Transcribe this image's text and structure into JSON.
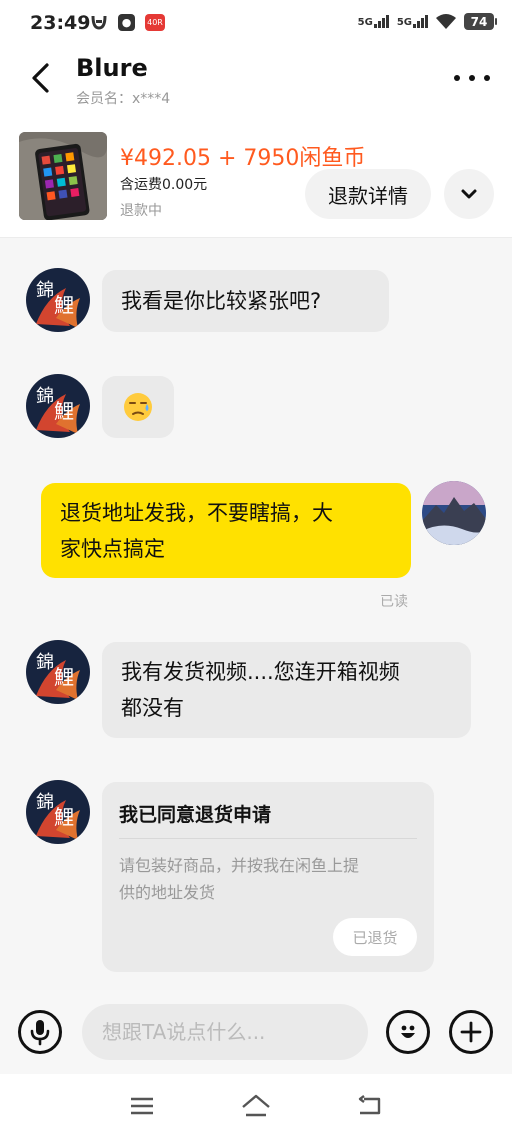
{
  "status_bar": {
    "time": "23:49",
    "signal_1": "5G",
    "signal_2": "5G",
    "battery": "74",
    "badge": "40R"
  },
  "header": {
    "name": "Blure",
    "member": "会员名：x***4"
  },
  "product": {
    "price": "¥492.05 + 7950闲鱼币",
    "shipping": "含运费0.00元",
    "status": "退款中",
    "refund_button": "退款详情"
  },
  "messages": [
    {
      "side": "in",
      "text": "我看是你比较紧张吧?"
    },
    {
      "side": "in",
      "text": "😓"
    },
    {
      "side": "out",
      "text": "退货地址发我，不要瞎搞，大家快点搞定",
      "line1": "退货地址发我，不要瞎搞，大",
      "line2": "家快点搞定",
      "status": "已读"
    },
    {
      "side": "in",
      "text": "我有发货视频....您连开箱视频都没有",
      "line1": "我有发货视频....您连开箱视频",
      "line2": "都没有"
    }
  ],
  "card": {
    "title": "我已同意退货申请",
    "body": "请包装好商品，并按我在闲鱼上提供的地址发货",
    "body_line1": "请包装好商品，并按我在闲鱼上提",
    "body_line2": "供的地址发货",
    "button": "已退货"
  },
  "input": {
    "placeholder": "想跟TA说点什么..."
  },
  "icons": {
    "back": "chevron-left-icon",
    "more": "more-dots-icon",
    "expand": "chevron-down-icon",
    "voice": "microphone-icon",
    "emoji": "emoji-icon",
    "add": "plus-icon",
    "nav_menu": "menu-icon",
    "nav_home": "home-icon",
    "nav_back": "back-icon"
  },
  "colors": {
    "price": "#ff5a1f",
    "outgoing_bubble": "#ffe100",
    "incoming_bubble": "#eaeaea"
  }
}
